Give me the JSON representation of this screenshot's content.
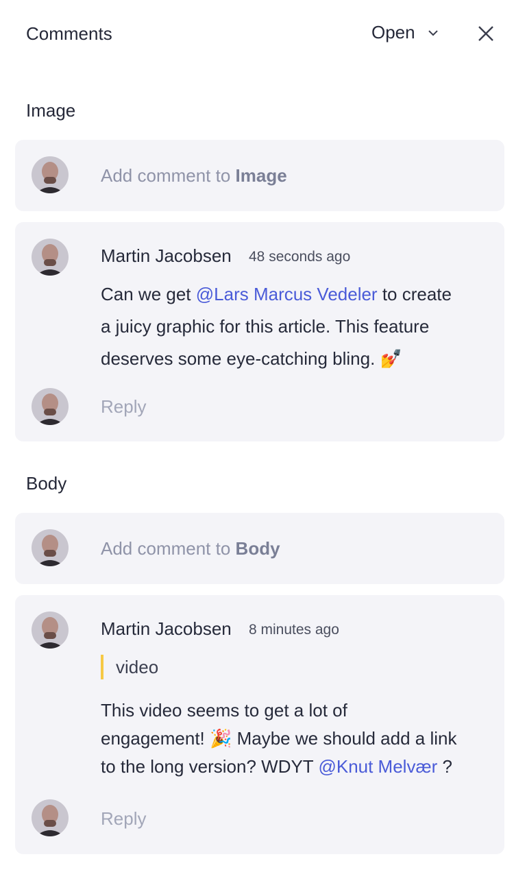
{
  "header": {
    "title": "Comments",
    "filter_label": "Open"
  },
  "sections": [
    {
      "title": "Image",
      "add_prefix": "Add comment to ",
      "add_target": "Image",
      "thread": {
        "author": "Martin Jacobsen",
        "time": "48 seconds ago",
        "body": {
          "part1": "Can we get ",
          "mention": "@Lars Marcus Vedeler",
          "part2": " to create",
          "line2": "a juicy graphic for this article. This feature",
          "line3": "deserves some eye-catching bling. 💅"
        },
        "reply_placeholder": "Reply"
      }
    },
    {
      "title": "Body",
      "add_prefix": "Add comment to ",
      "add_target": "Body",
      "thread": {
        "author": "Martin Jacobsen",
        "time": "8 minutes ago",
        "quote": "video",
        "body": {
          "line1": "This video seems to get a lot of",
          "line2": "engagement! 🎉 Maybe we should add a link",
          "line3_prefix": "to the long version? WDYT ",
          "mention": "@Knut Melvær",
          "line3_suffix": " ?"
        },
        "reply_placeholder": "Reply"
      }
    }
  ],
  "colors": {
    "card_bg": "#f4f4f8",
    "mention": "#4a5bd8",
    "quote_bar": "#f6c945"
  }
}
